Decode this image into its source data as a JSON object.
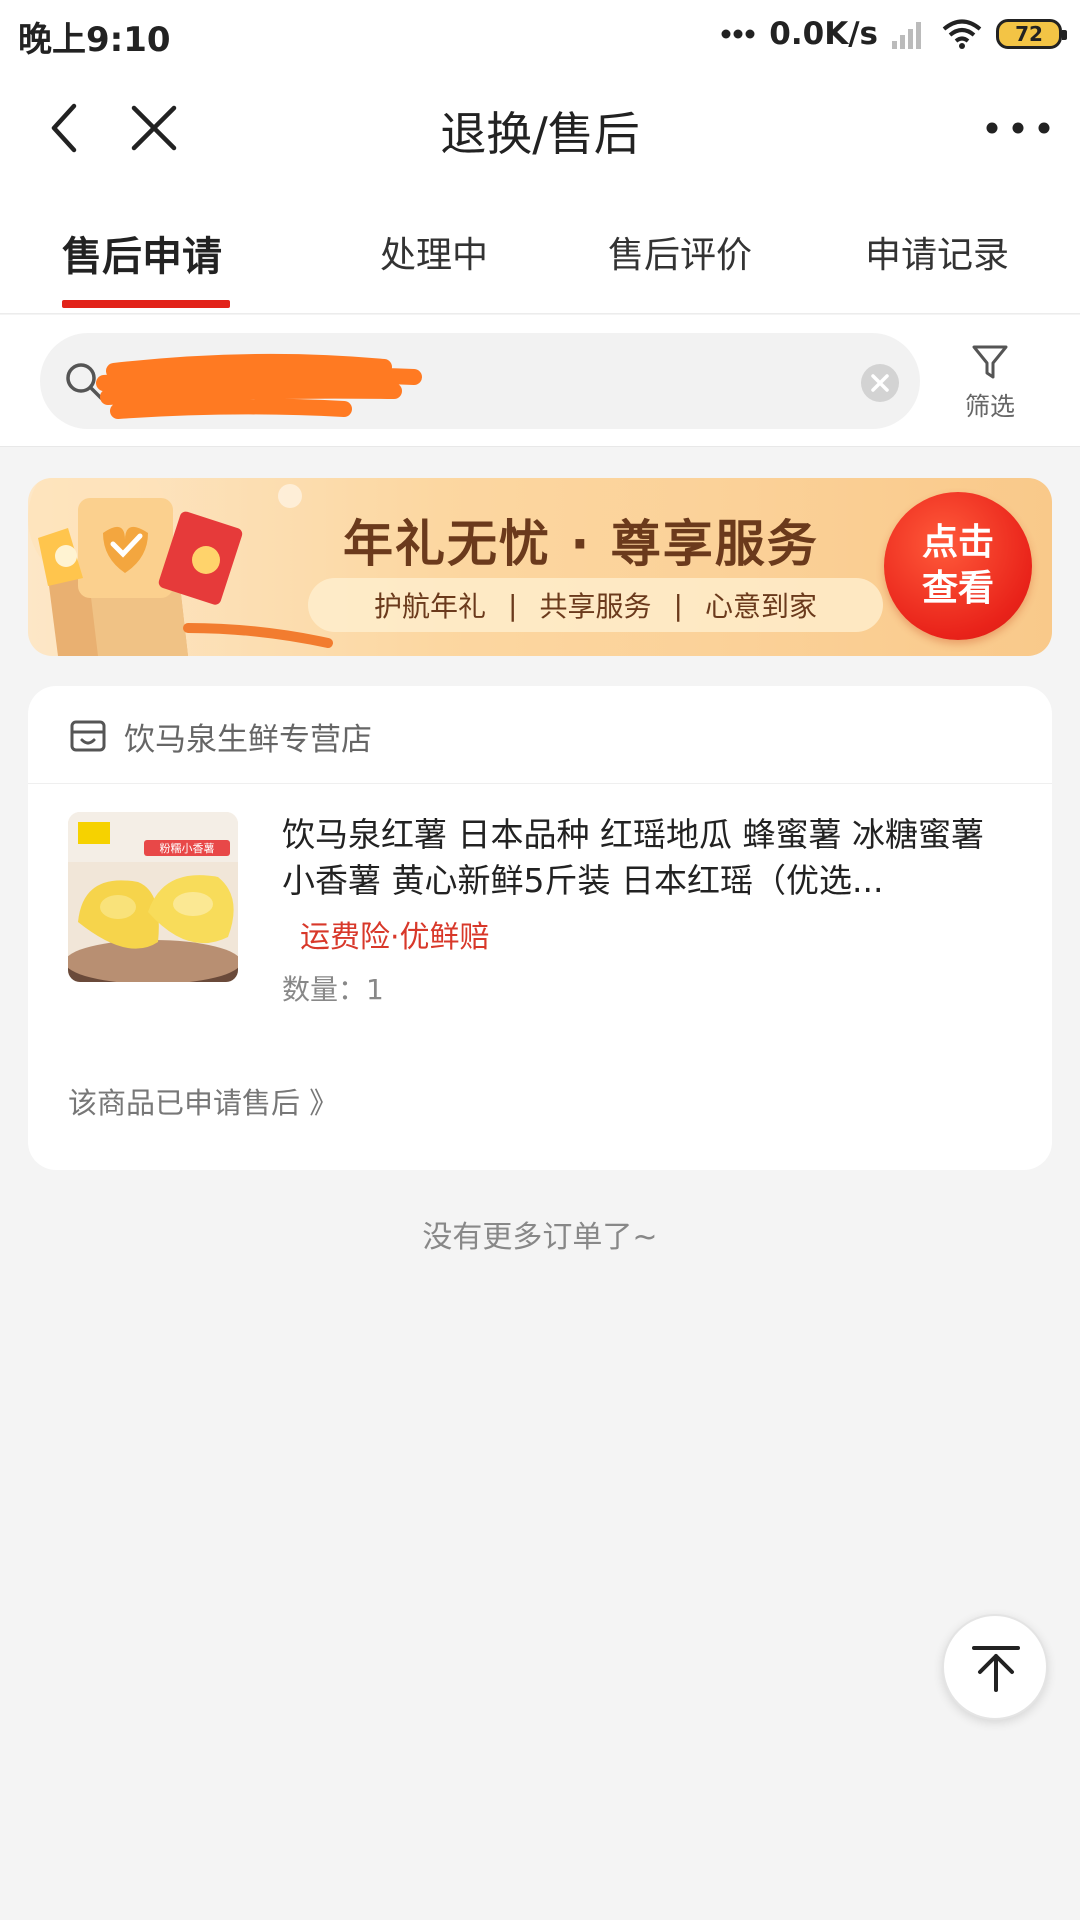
{
  "status_bar": {
    "time": "晚上9:10",
    "net_speed": "0.0K/s",
    "battery": "72"
  },
  "nav": {
    "title": "退换/售后"
  },
  "tabs": [
    {
      "label": "售后申请",
      "active": true
    },
    {
      "label": "处理中",
      "active": false
    },
    {
      "label": "售后评价",
      "active": false
    },
    {
      "label": "申请记录",
      "active": false
    }
  ],
  "search": {
    "value": "",
    "filter_label": "筛选"
  },
  "banner": {
    "title": "年礼无忧 · 尊享服务",
    "items": [
      "护航年礼",
      "共享服务",
      "心意到家"
    ],
    "cta": "点击\n查看"
  },
  "order": {
    "shop_name": "饮马泉生鲜专营店",
    "product_title": "饮马泉红薯 日本品种 红瑶地瓜 蜂蜜薯 冰糖蜜薯小香薯 黄心新鲜5斤装 日本红瑶（优选...",
    "product_image_label": "粉糯小香薯",
    "tag": "运费险·优鲜赔",
    "quantity": "数量：1",
    "after_sale_link": "该商品已申请售后 》"
  },
  "footer": {
    "no_more": "没有更多订单了~"
  },
  "colors": {
    "accent": "#e2231a",
    "tag_red": "#d8382a",
    "banner_text": "#6b3a1c"
  }
}
